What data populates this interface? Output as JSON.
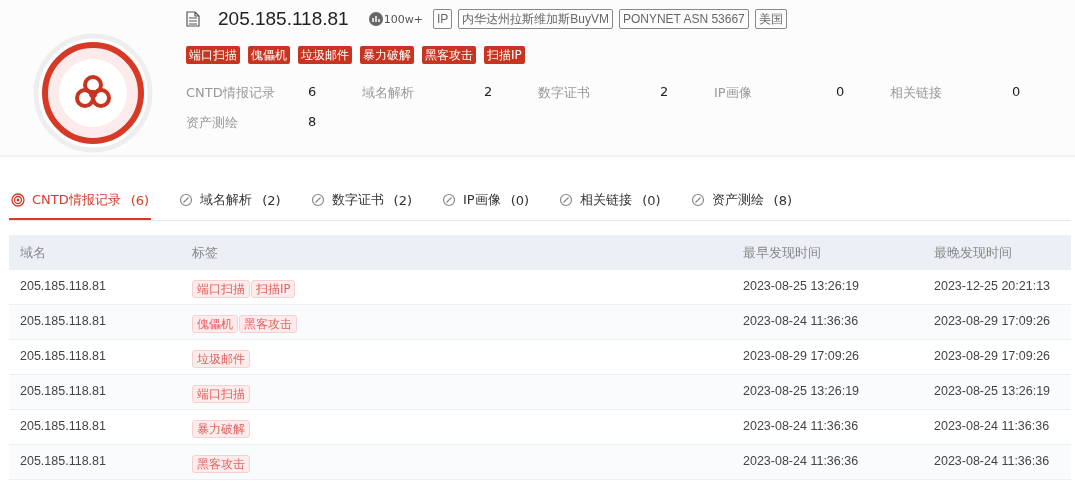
{
  "header": {
    "ip": "205.185.118.81",
    "heat": "100w+",
    "info_tags": [
      "IP",
      "内华达州拉斯维加斯BuyVM",
      "PONYNET ASN 53667",
      "美国"
    ],
    "threat_tags": [
      "端口扫描",
      "傀儡机",
      "垃圾邮件",
      "暴力破解",
      "黑客攻击",
      "扫描IP"
    ],
    "stats": [
      {
        "label": "CNTD情报记录",
        "value": "6"
      },
      {
        "label": "域名解析",
        "value": "2"
      },
      {
        "label": "数字证书",
        "value": "2"
      },
      {
        "label": "IP画像",
        "value": "0"
      },
      {
        "label": "相关链接",
        "value": "0"
      },
      {
        "label": "资产测绘",
        "value": "8"
      }
    ]
  },
  "tabs": [
    {
      "label": "CNTD情报记录",
      "count": "(6)",
      "selected": true
    },
    {
      "label": "域名解析",
      "count": "(2)",
      "selected": false
    },
    {
      "label": "数字证书",
      "count": "(2)",
      "selected": false
    },
    {
      "label": "IP画像",
      "count": "(0)",
      "selected": false
    },
    {
      "label": "相关链接",
      "count": "(0)",
      "selected": false
    },
    {
      "label": "资产测绘",
      "count": "(8)",
      "selected": false
    }
  ],
  "table": {
    "columns": [
      "域名",
      "标签",
      "最早发现时间",
      "最晚发现时间"
    ],
    "rows": [
      {
        "domain": "205.185.118.81",
        "tags": [
          "端口扫描",
          "扫描IP"
        ],
        "first": "2023-08-25 13:26:19",
        "last": "2023-12-25 20:21:13"
      },
      {
        "domain": "205.185.118.81",
        "tags": [
          "傀儡机",
          "黑客攻击"
        ],
        "first": "2023-08-24 11:36:36",
        "last": "2023-08-29 17:09:26"
      },
      {
        "domain": "205.185.118.81",
        "tags": [
          "垃圾邮件"
        ],
        "first": "2023-08-29 17:09:26",
        "last": "2023-08-29 17:09:26"
      },
      {
        "domain": "205.185.118.81",
        "tags": [
          "端口扫描"
        ],
        "first": "2023-08-25 13:26:19",
        "last": "2023-08-25 13:26:19"
      },
      {
        "domain": "205.185.118.81",
        "tags": [
          "暴力破解"
        ],
        "first": "2023-08-24 11:36:36",
        "last": "2023-08-24 11:36:36"
      },
      {
        "domain": "205.185.118.81",
        "tags": [
          "黑客攻击"
        ],
        "first": "2023-08-24 11:36:36",
        "last": "2023-08-24 11:36:36"
      }
    ]
  }
}
